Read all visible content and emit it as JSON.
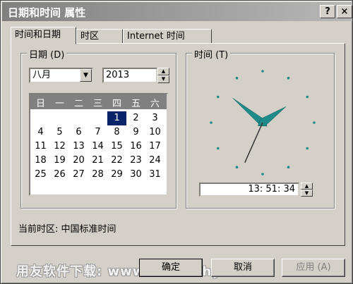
{
  "window": {
    "title": "日期和时间 属性",
    "help_label": "?",
    "close_label": "×"
  },
  "tabs": [
    {
      "label": "时间和日期",
      "active": true
    },
    {
      "label": "时区",
      "active": false
    },
    {
      "label": "Internet 时间",
      "active": false
    }
  ],
  "date_group": {
    "title": "日期 (D)",
    "month": "八月",
    "year": "2013",
    "day_names": [
      "日",
      "一",
      "二",
      "三",
      "四",
      "五",
      "六"
    ],
    "weeks": [
      [
        "",
        "",
        "",
        "",
        "1",
        "2",
        "3"
      ],
      [
        "4",
        "5",
        "6",
        "7",
        "8",
        "9",
        "10"
      ],
      [
        "11",
        "12",
        "13",
        "14",
        "15",
        "16",
        "17"
      ],
      [
        "18",
        "19",
        "20",
        "21",
        "22",
        "23",
        "24"
      ],
      [
        "25",
        "26",
        "27",
        "28",
        "29",
        "30",
        "31"
      ]
    ],
    "selected_day": "1"
  },
  "time_group": {
    "title": "时间 (T)",
    "time_value": "13: 51: 34",
    "clock": {
      "hour": 13,
      "minute": 51,
      "second": 34
    }
  },
  "timezone": {
    "label": "当前时区: 中国标准时间"
  },
  "buttons": {
    "ok": "确定",
    "cancel": "取消",
    "apply": "应用 (A)"
  },
  "watermark": "用友软件下载: www.ufidawhy.com",
  "colors": {
    "clock_hand": "#1f8a8a",
    "selection": "#0a246a",
    "calendar_header": "#808080"
  }
}
